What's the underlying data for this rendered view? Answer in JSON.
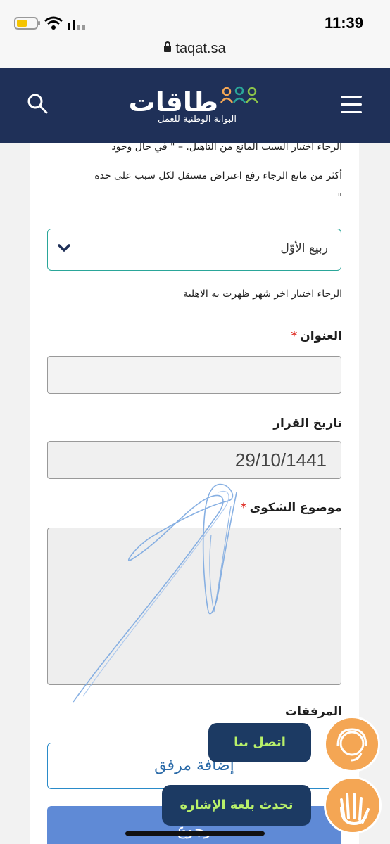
{
  "status": {
    "time": "11:39",
    "url": "taqat.sa"
  },
  "header": {
    "logo_title": "طاقات",
    "logo_subtitle": "البوابة الوطنية للعمل"
  },
  "form": {
    "intro_line1": "الرجاء اختيار السبب المانع من التاهيل. – \" في حال وجود",
    "intro_line2": "أكثر من مانع الرجاء رفع اعتراض مستقل لكل سبب على حده",
    "intro_line3": "\"",
    "month_select_value": "ربيع الأوّل",
    "month_hint": "الرجاء اختيار اخر شهر ظهرت به الاهلية",
    "title_label": "العنوان",
    "title_required": "*",
    "title_value": "",
    "decision_date_label": "تاريخ القرار",
    "decision_date_value": "29/10/1441",
    "complaint_label": "موضوع الشكوى",
    "complaint_required": "*",
    "complaint_value": "",
    "attachments_label": "المرفقات",
    "add_attachment_label": "إضافة مرفق",
    "back_button_label": "رجوع"
  },
  "floating": {
    "contact_label": "اتصل بنا",
    "sign_language_label": "تحدث بلغة الإشارة"
  },
  "colors": {
    "header_bg": "#1f3058",
    "accent_teal": "#2aa699",
    "required_red": "#e0332a",
    "float_orange": "#f4a654",
    "float_pill": "#1c3a63",
    "float_text": "#b8f06a"
  },
  "icons": [
    "battery-icon",
    "wifi-icon",
    "signal-icon",
    "lock-icon",
    "search-icon",
    "menu-icon",
    "chevron-down-icon",
    "headset-icon",
    "hand-wave-icon"
  ]
}
